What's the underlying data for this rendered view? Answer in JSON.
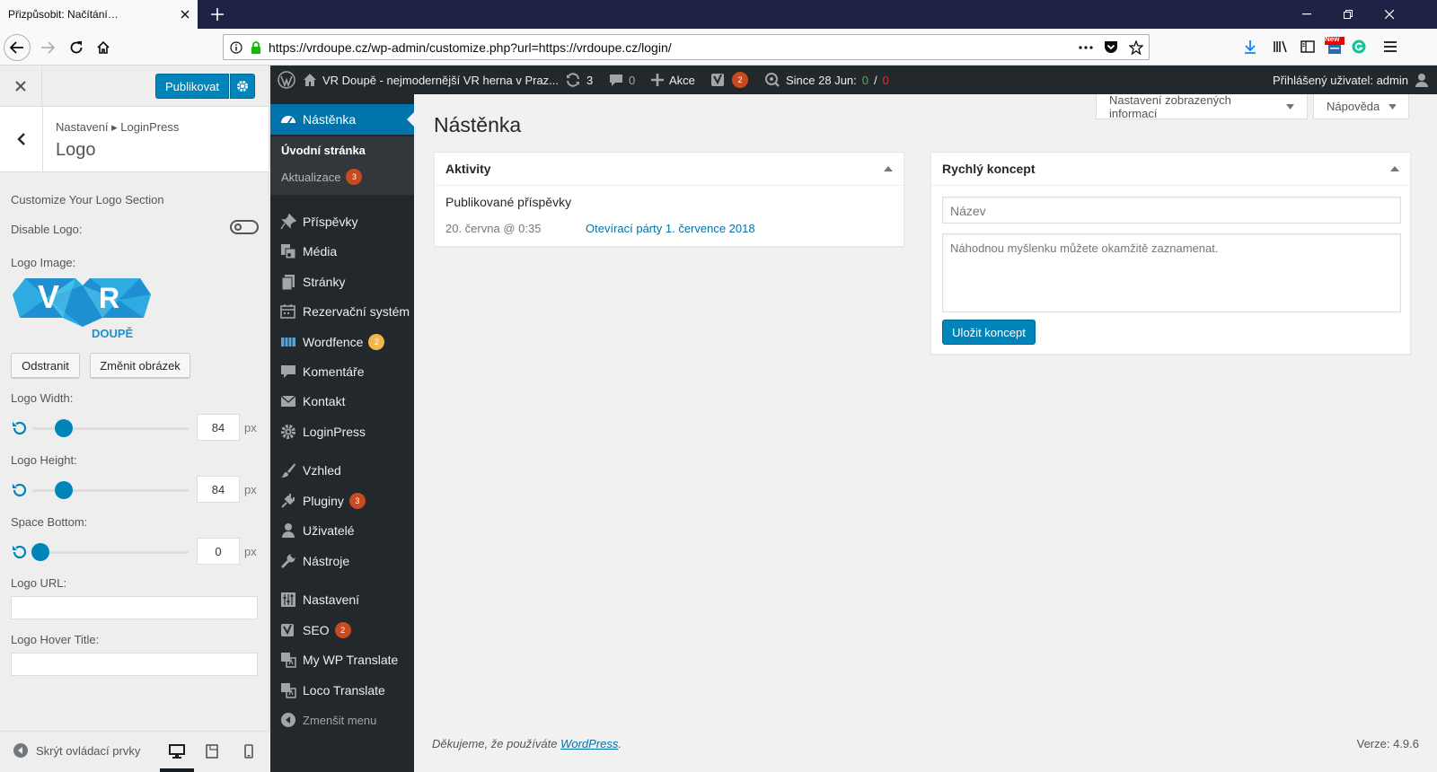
{
  "browser": {
    "tab_title": "Přizpůsobit: Načítání…",
    "url": "https://vrdoupe.cz/wp-admin/customize.php?url=https://vrdoupe.cz/login/",
    "new_badge": "New"
  },
  "customizer": {
    "publish_label": "Publikovat",
    "breadcrumb": "Nastavení ▸ LoginPress",
    "section_title": "Logo",
    "section_heading": "Customize Your Logo Section",
    "disable_logo_label": "Disable Logo:",
    "logo_image_label": "Logo Image:",
    "logo_text_v": "V",
    "logo_text_r": "R",
    "logo_text_brand": "DOUPĚ",
    "remove_label": "Odstranit",
    "change_image_label": "Změnit obrázek",
    "width_label": "Logo Width:",
    "width_value": "84",
    "width_fraction": 0.2,
    "height_label": "Logo Height:",
    "height_value": "84",
    "height_fraction": 0.2,
    "space_label": "Space Bottom:",
    "space_value": "0",
    "space_fraction": 0.05,
    "unit": "px",
    "url_label": "Logo URL:",
    "hover_title_label": "Logo Hover Title:",
    "hide_controls_label": "Skrýt ovládací prvky"
  },
  "adminbar": {
    "site_name": "VR Doupě - nejmodernější VR herna v Praz...",
    "updates_count": "3",
    "comments_count": "0",
    "new_label": "Akce",
    "yoast_count": "2",
    "since_label": "Since 28 Jun:",
    "since_green": "0",
    "since_sep": "/",
    "since_red": "0",
    "user_label": "Přihlášený uživatel: admin"
  },
  "menu": {
    "dashboard": "Nástěnka",
    "home": "Úvodní stránka",
    "updates": "Aktualizace",
    "updates_count": "3",
    "posts": "Příspěvky",
    "media": "Média",
    "pages": "Stránky",
    "booking": "Rezervační systém",
    "wordfence": "Wordfence",
    "wordfence_count": "2",
    "comments": "Komentáře",
    "contact": "Kontakt",
    "loginpress": "LoginPress",
    "appearance": "Vzhled",
    "plugins": "Pluginy",
    "plugins_count": "3",
    "users": "Uživatelé",
    "tools": "Nástroje",
    "settings": "Nastavení",
    "seo": "SEO",
    "seo_count": "2",
    "mywp": "My WP Translate",
    "loco": "Loco Translate",
    "collapse": "Zmenšit menu"
  },
  "main": {
    "screen_options": "Nastavení zobrazených informací",
    "help": "Nápověda",
    "title": "Nástěnka",
    "activity": {
      "title": "Aktivity",
      "subtitle": "Publikované příspěvky",
      "date": "20. června @ 0:35",
      "post_link": "Otevírací párty 1. července 2018"
    },
    "quick_draft": {
      "title": "Rychlý koncept",
      "title_placeholder": "Název",
      "content_placeholder": "Náhodnou myšlenku můžete okamžitě zaznamenat.",
      "save_label": "Uložit koncept"
    },
    "footer_thanks": "Děkujeme, že používáte",
    "footer_link": "WordPress",
    "footer_period": ".",
    "version": "Verze: 4.9.6"
  },
  "colors": {
    "wp_blue": "#0085ba",
    "admin_dark": "#23282d",
    "menu_active": "#0073aa",
    "bubble": "#ca4a1f",
    "wordfence_bubble": "#f0b849",
    "browser_dark": "#1e2244",
    "since_green": "#46b450",
    "since_red": "#dc3232"
  }
}
